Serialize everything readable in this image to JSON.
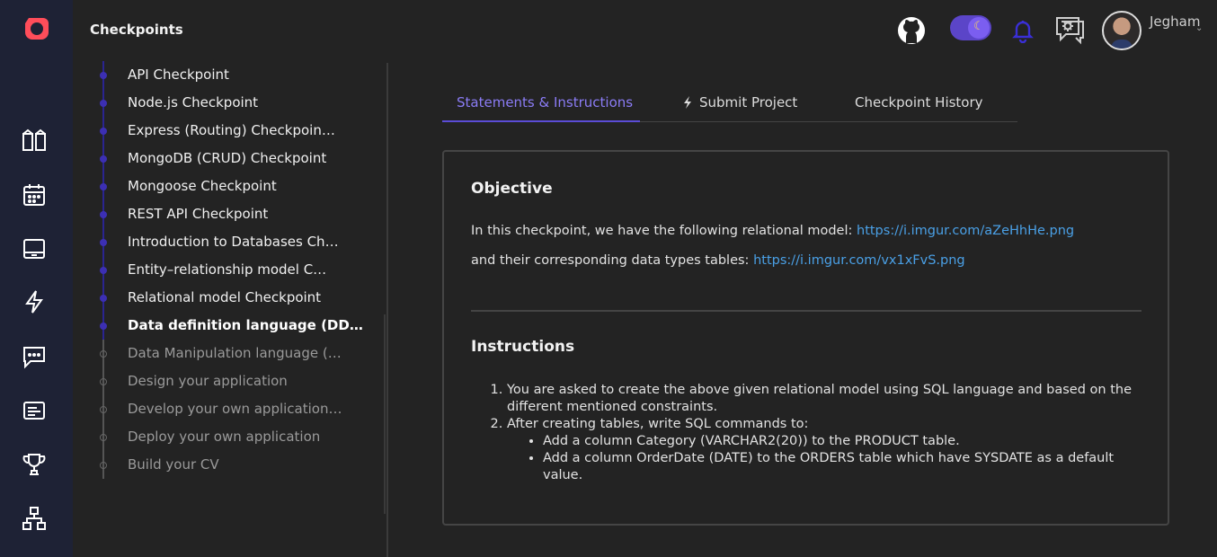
{
  "header": {
    "title": "Checkpoints",
    "user_name": "Jegham"
  },
  "rail": {
    "icons": [
      "logo-icon",
      "courses-icon",
      "calendar-icon",
      "laptop-icon",
      "bolt-icon",
      "chat-icon",
      "news-icon",
      "trophy-icon",
      "hierarchy-icon"
    ]
  },
  "steps": [
    {
      "label": "API Checkpoint",
      "state": "done"
    },
    {
      "label": "Node.js Checkpoint",
      "state": "done"
    },
    {
      "label": "Express (Routing) Checkpoin…",
      "state": "done"
    },
    {
      "label": "MongoDB (CRUD) Checkpoint",
      "state": "done"
    },
    {
      "label": "Mongoose Checkpoint",
      "state": "done"
    },
    {
      "label": "REST API Checkpoint",
      "state": "done"
    },
    {
      "label": "Introduction to Databases Ch…",
      "state": "done"
    },
    {
      "label": "Entity–relationship model C…",
      "state": "done"
    },
    {
      "label": "Relational model Checkpoint",
      "state": "done"
    },
    {
      "label": "Data definition language (DD…",
      "state": "current"
    },
    {
      "label": "Data Manipulation language (…",
      "state": "todo"
    },
    {
      "label": "Design your application",
      "state": "todo"
    },
    {
      "label": "Develop your own application…",
      "state": "todo"
    },
    {
      "label": "Deploy your own application",
      "state": "todo"
    },
    {
      "label": "Build your CV",
      "state": "todo"
    }
  ],
  "tabs": [
    {
      "label": "Statements & Instructions",
      "active": true
    },
    {
      "label": "Submit Project",
      "active": false
    },
    {
      "label": "Checkpoint History",
      "active": false
    }
  ],
  "content": {
    "objective_heading": "Objective",
    "objective_line1": "In this checkpoint, we have the following relational model: ",
    "objective_link1": "https://i.imgur.com/aZeHhHe.png",
    "objective_line2": "and their corresponding data types tables: ",
    "objective_link2": "https://i.imgur.com/vx1xFvS.png",
    "instructions_heading": "Instructions",
    "instructions": [
      "You are asked to create the above given relational model using SQL language and based on the different mentioned constraints.",
      "After creating tables, write SQL commands to:"
    ],
    "sub_instructions": [
      "Add a column Category (VARCHAR2(20)) to the PRODUCT table.",
      "Add a column OrderDate (DATE)  to the ORDERS table which have SYSDATE as a default value."
    ]
  },
  "colors": {
    "accent": "#5b4cd6",
    "link": "#4aa0e6",
    "rail_bg": "#1e2235",
    "logo": "#ff4d5a"
  }
}
